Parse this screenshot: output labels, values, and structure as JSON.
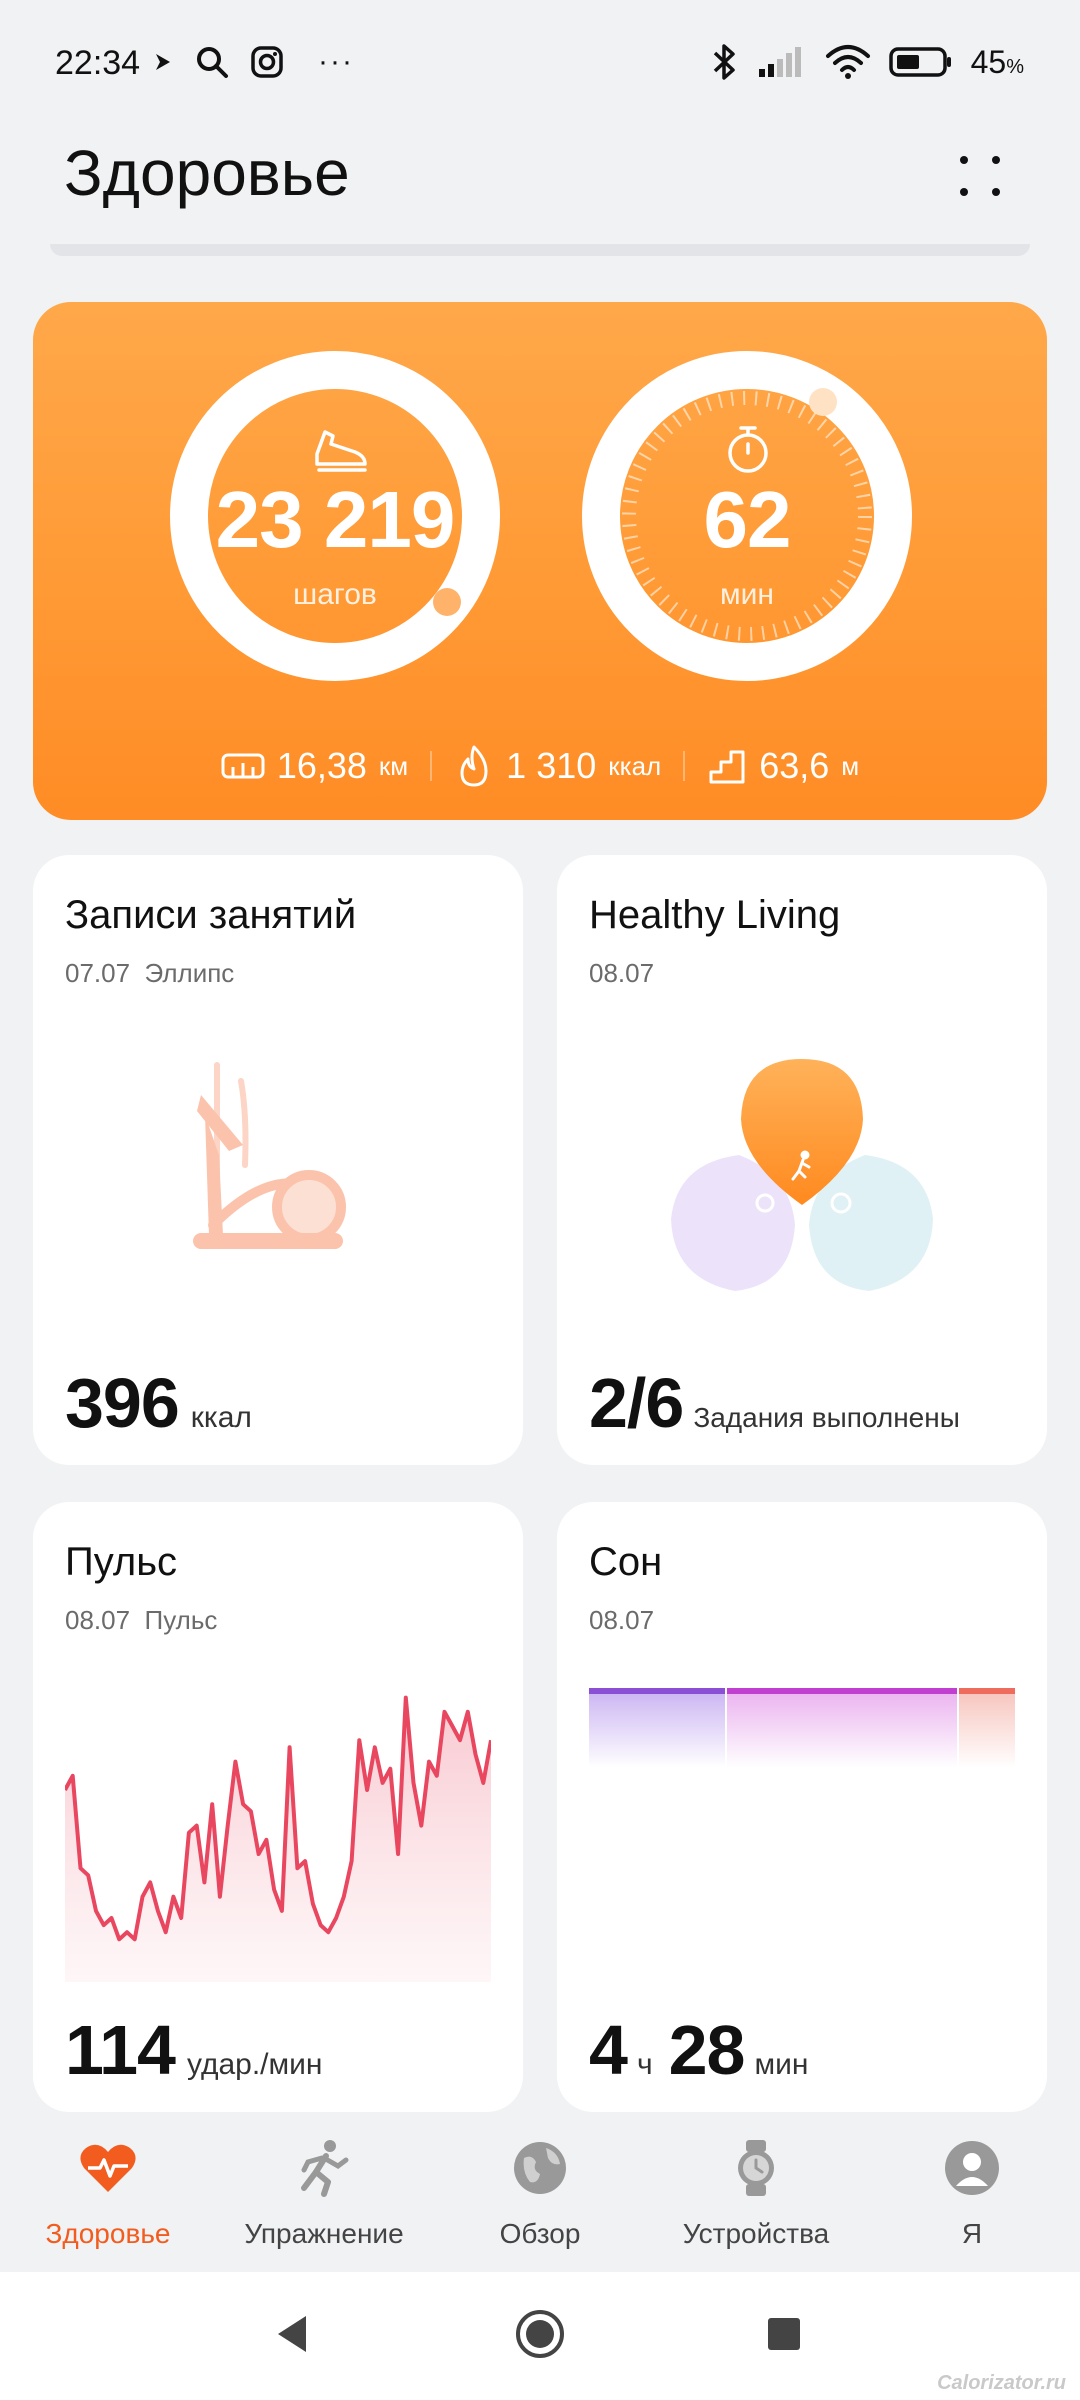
{
  "status_bar": {
    "time": "22:34",
    "more": "···",
    "battery_pct": "45",
    "battery_unit": "%"
  },
  "header": {
    "title": "Здоровье"
  },
  "activity": {
    "steps_value": "23 219",
    "steps_unit": "шагов",
    "steps_progress": 0.98,
    "minutes_value": "62",
    "minutes_unit": "мин",
    "minutes_progress": 1.0,
    "distance_value": "16,38",
    "distance_unit": "км",
    "calories_value": "1 310",
    "calories_unit": "ккал",
    "climb_value": "63,6",
    "climb_unit": "м",
    "accent": "#ff9a35"
  },
  "workout_card": {
    "title": "Записи занятий",
    "date": "07.07",
    "type": "Эллипс",
    "value": "396",
    "unit": "ккал"
  },
  "healthy_card": {
    "title": "Healthy Living",
    "date": "08.07",
    "value": "2/6",
    "unit": "Задания выполнены"
  },
  "pulse_card": {
    "title": "Пульс",
    "date": "08.07",
    "subtitle": "Пульс",
    "value": "114",
    "unit": "удар./мин",
    "line_color": "#e8475f",
    "chart_data": {
      "type": "area",
      "x": [
        0,
        1,
        2,
        3,
        4,
        5,
        6,
        7,
        8,
        9,
        10,
        11,
        12,
        13,
        14,
        15,
        16,
        17,
        18,
        19,
        20,
        21,
        22,
        23,
        24,
        25,
        26,
        27,
        28,
        29,
        30,
        31,
        32,
        33,
        34,
        35,
        36,
        37,
        38,
        39,
        40,
        41,
        42,
        43,
        44,
        45,
        46,
        47,
        48,
        49,
        50,
        51,
        52,
        53,
        54,
        55
      ],
      "y": [
        97,
        99,
        86,
        85,
        80,
        78,
        79,
        76,
        77,
        76,
        82,
        84,
        80,
        77,
        82,
        79,
        91,
        92,
        84,
        95,
        82,
        92,
        101,
        95,
        94,
        88,
        90,
        83,
        80,
        103,
        86,
        87,
        81,
        78,
        77,
        79,
        82,
        87,
        104,
        97,
        103,
        98,
        100,
        88,
        110,
        98,
        92,
        101,
        99,
        108,
        106,
        104,
        108,
        102,
        98,
        104
      ],
      "ylim": [
        70,
        115
      ],
      "grid": false
    }
  },
  "sleep_card": {
    "title": "Сон",
    "date": "08.07",
    "hours_value": "4",
    "hours_unit": "ч",
    "minutes_value": "28",
    "minutes_unit": "мин"
  },
  "bottom_nav": {
    "items": [
      {
        "label": "Здоровье"
      },
      {
        "label": "Упражнение"
      },
      {
        "label": "Обзор"
      },
      {
        "label": "Устройства"
      },
      {
        "label": "Я"
      }
    ],
    "active_color": "#f25c1f"
  },
  "watermark": "Calorizator.ru"
}
